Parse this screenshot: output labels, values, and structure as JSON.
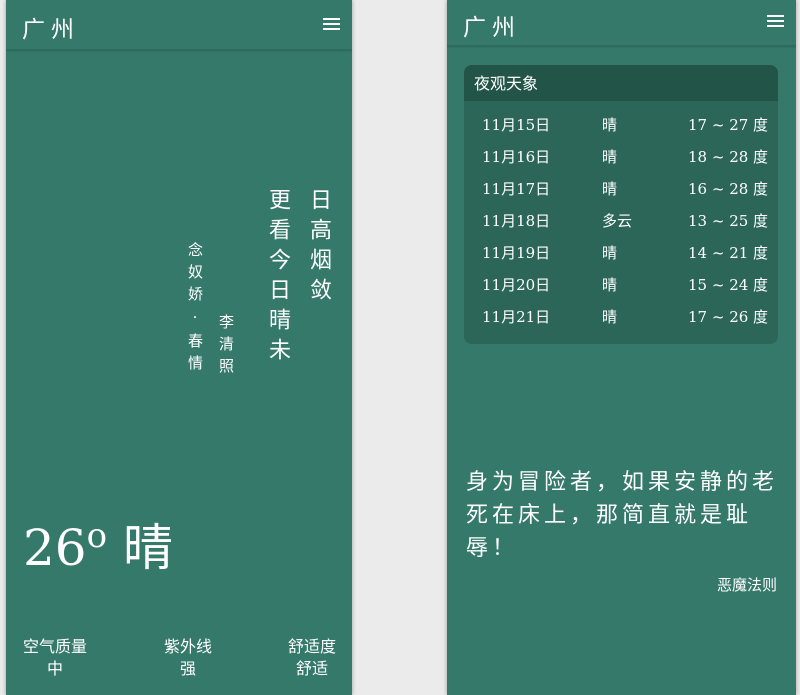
{
  "left": {
    "city": "广州",
    "poem": {
      "lines": [
        "日高烟敛",
        "更看今日晴未"
      ],
      "title": "念奴娇·春情",
      "author": "李清照"
    },
    "temperature": "26",
    "degree_mark": "o",
    "condition": "晴",
    "stats": [
      {
        "label": "空气质量",
        "value": "中"
      },
      {
        "label": "紫外线",
        "value": "强"
      },
      {
        "label": "舒适度",
        "value": "舒适"
      }
    ]
  },
  "right": {
    "city": "广州",
    "forecast": {
      "title": "夜观天象",
      "rows": [
        {
          "date": "11月15日",
          "cond": "晴",
          "range": "17 ~ 27 度"
        },
        {
          "date": "11月16日",
          "cond": "晴",
          "range": "18 ~ 28 度"
        },
        {
          "date": "11月17日",
          "cond": "晴",
          "range": "16 ~ 28 度"
        },
        {
          "date": "11月18日",
          "cond": "多云",
          "range": "13 ~ 25 度"
        },
        {
          "date": "11月19日",
          "cond": "晴",
          "range": "14 ~ 21 度"
        },
        {
          "date": "11月20日",
          "cond": "晴",
          "range": "15 ~ 24 度"
        },
        {
          "date": "11月21日",
          "cond": "晴",
          "range": "17 ~ 26 度"
        }
      ]
    },
    "quote": "身为冒险者，如果安静的老死在床上，那简直就是耻辱！",
    "quote_source": "恶魔法则"
  },
  "icons": {
    "menu": "hamburger-menu-icon"
  },
  "colors": {
    "panel_bg": "#35796b",
    "card_bg": "#2b6658",
    "card_head": "#225448",
    "page_bg": "#ebebeb"
  }
}
